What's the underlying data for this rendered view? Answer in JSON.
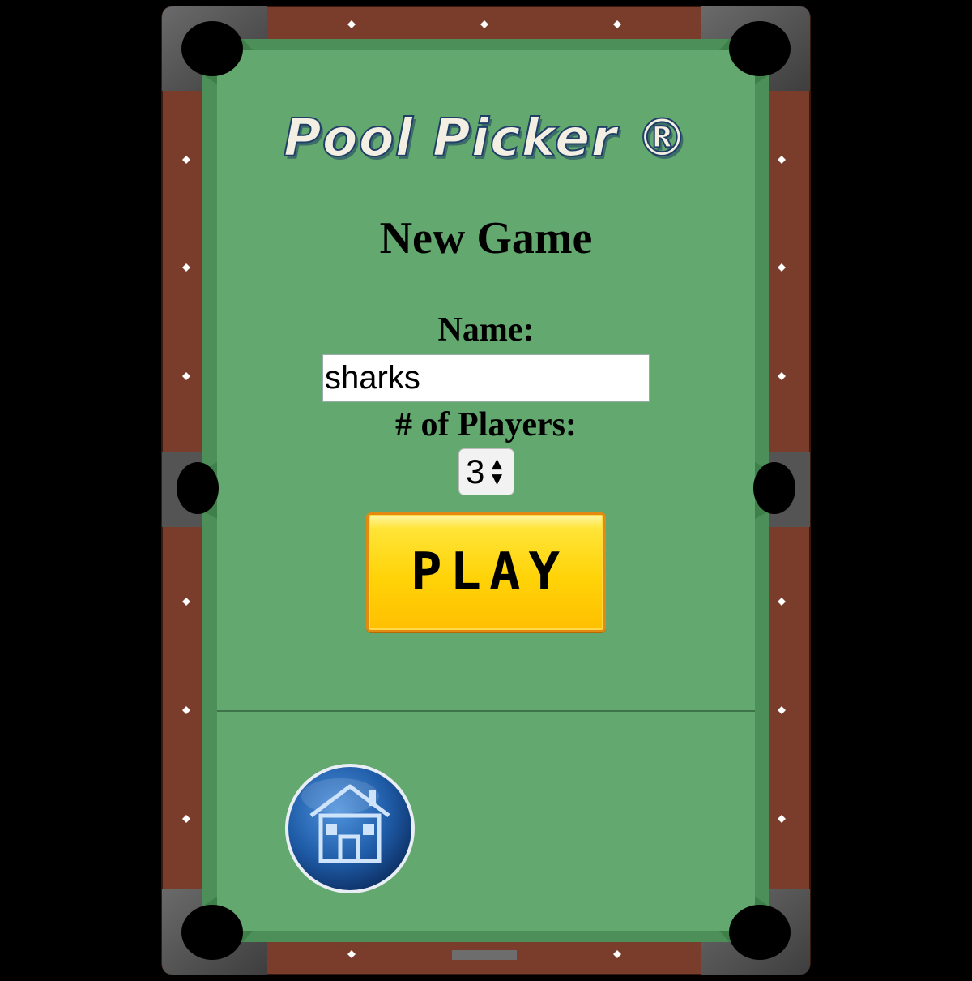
{
  "app": {
    "title": "Pool Picker ®"
  },
  "screen": {
    "heading": "New Game"
  },
  "form": {
    "name_label": "Name:",
    "name_value": "sharks",
    "players_label": "# of Players:",
    "players_value": "3",
    "play_label": "PLAY"
  },
  "icons": {
    "home": "home-icon",
    "stepper_up": "triangle-up-icon",
    "stepper_down": "triangle-down-icon"
  },
  "colors": {
    "felt": "#63a86f",
    "rail_wood": "#7b3d2b",
    "corner_metal": "#545454",
    "play_button": "#ffd308",
    "home_button": "#1f5ca8"
  }
}
